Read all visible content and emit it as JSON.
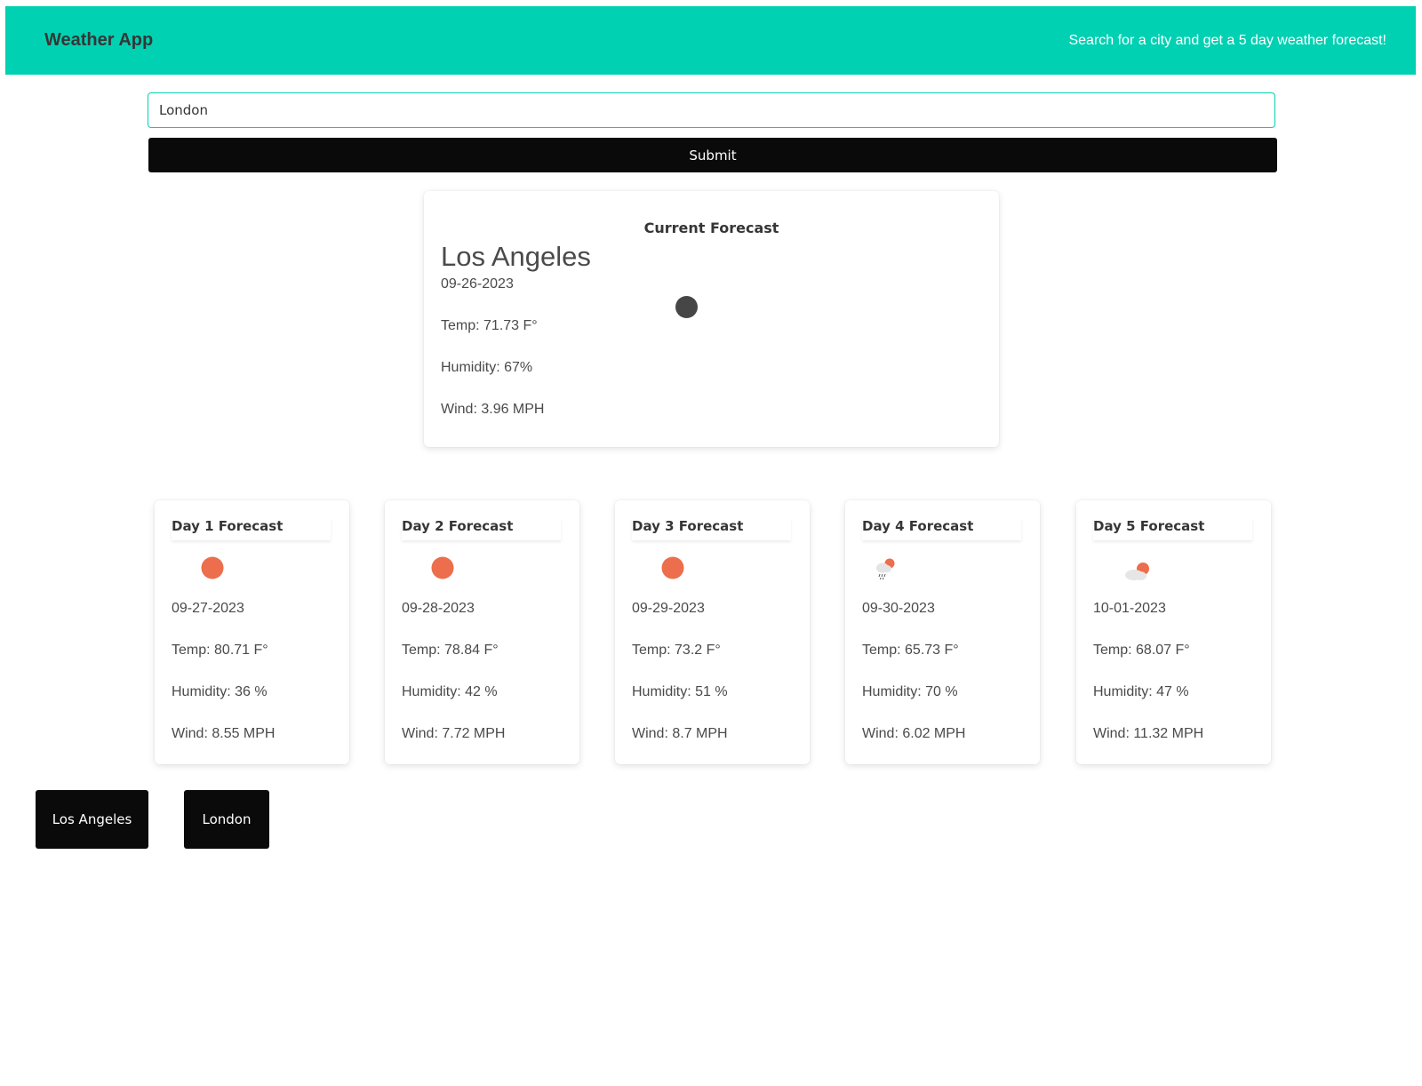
{
  "header": {
    "title": "Weather App",
    "tagline": "Search for a city and get a 5 day weather forecast!"
  },
  "search": {
    "value": "London",
    "submit_label": "Submit"
  },
  "current": {
    "heading": "Current Forecast",
    "city": "Los Angeles",
    "date": "09-26-2023",
    "temp": "Temp: 71.73 F°",
    "humidity": "Humidity: 67%",
    "wind": "Wind: 3.96 MPH",
    "icon": "night-clear-icon",
    "icon_color": "#464646"
  },
  "forecast": [
    {
      "title": "Day 1 Forecast",
      "date": "09-27-2023",
      "temp": "Temp: 80.71 F°",
      "humidity": "Humidity: 36 %",
      "wind": "Wind: 8.55 MPH",
      "icon": "sun-icon"
    },
    {
      "title": "Day 2 Forecast",
      "date": "09-28-2023",
      "temp": "Temp: 78.84 F°",
      "humidity": "Humidity: 42 %",
      "wind": "Wind: 7.72 MPH",
      "icon": "sun-icon"
    },
    {
      "title": "Day 3 Forecast",
      "date": "09-29-2023",
      "temp": "Temp: 73.2 F°",
      "humidity": "Humidity: 51 %",
      "wind": "Wind: 8.7 MPH",
      "icon": "sun-icon"
    },
    {
      "title": "Day 4 Forecast",
      "date": "09-30-2023",
      "temp": "Temp: 65.73 F°",
      "humidity": "Humidity: 70 %",
      "wind": "Wind: 6.02 MPH",
      "icon": "rain-sun-icon"
    },
    {
      "title": "Day 5 Forecast",
      "date": "10-01-2023",
      "temp": "Temp: 68.07 F°",
      "humidity": "Humidity: 47 %",
      "wind": "Wind: 11.32 MPH",
      "icon": "partly-cloudy-icon"
    }
  ],
  "history": [
    "Los Angeles",
    "London"
  ],
  "colors": {
    "accent": "#00d1b2",
    "sun": "#ec6e4c",
    "button": "#0a0a0a"
  }
}
